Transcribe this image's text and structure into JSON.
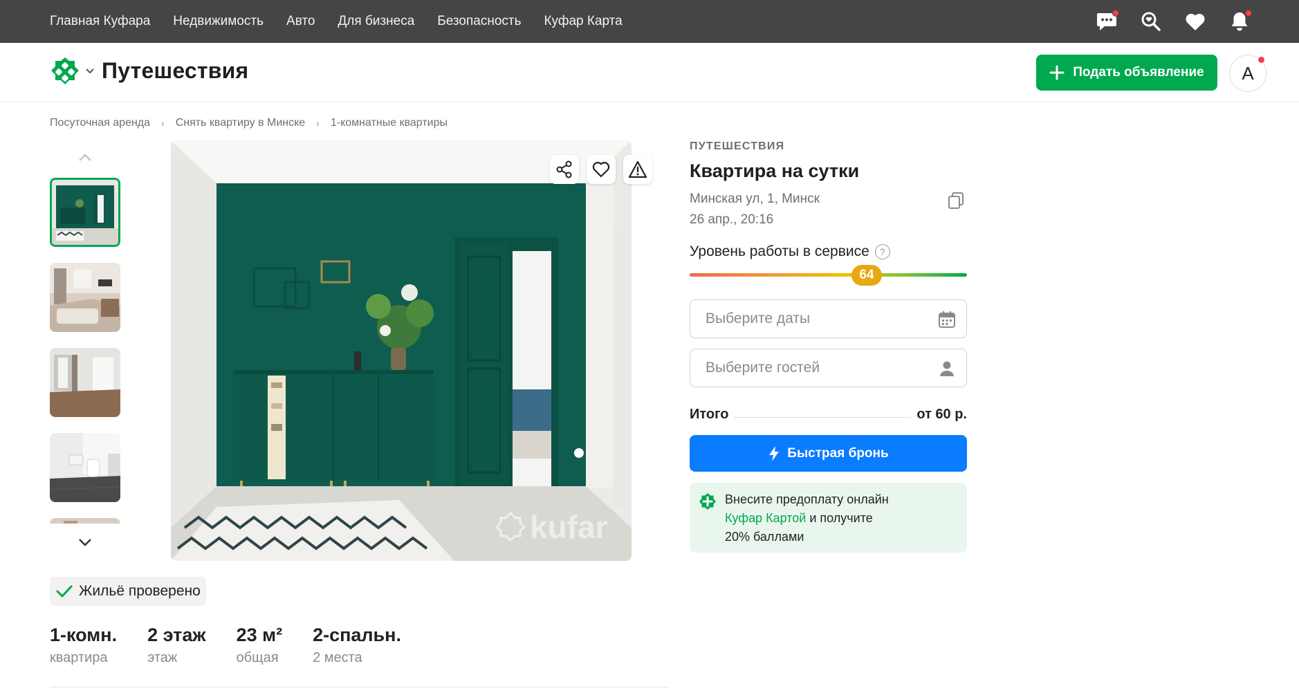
{
  "topnav": {
    "links": [
      "Главная Куфара",
      "Недвижимость",
      "Авто",
      "Для бизнеса",
      "Безопасность",
      "Куфар Карта"
    ],
    "icons": [
      "messages-icon",
      "saved-search-icon",
      "favorites-icon",
      "notifications-icon"
    ]
  },
  "header": {
    "section_title": "Путешествия",
    "post_button_label": "Подать объявление",
    "avatar_letter": "A"
  },
  "breadcrumb": [
    "Посуточная аренда",
    "Снять квартиру в Минске",
    "1-комнатные квартиры"
  ],
  "gallery": {
    "thumbnail_count_visible": 5,
    "active_thumbnail": 1,
    "watermark": "kufar"
  },
  "listing": {
    "category": "ПУТЕШЕСТВИЯ",
    "title": "Квартира на сутки",
    "address": "Минская ул, 1, Минск",
    "date": "26 апр., 20:16",
    "service_level_label": "Уровень работы в сервисе",
    "service_level_value": "64",
    "service_level_max": 100,
    "dates_placeholder": "Выберите даты",
    "guests_placeholder": "Выберите гостей",
    "total_label": "Итого",
    "total_value": "от 60 р.",
    "book_button_label": "Быстрая бронь",
    "promo": {
      "line1": "Внесите предоплату онлайн",
      "link": "Куфар Картой",
      "line2_rest": " и получите",
      "line3": "20% баллами"
    }
  },
  "verified_label": "Жильё проверено",
  "stats": [
    {
      "value": "1-комн.",
      "label": "квартира"
    },
    {
      "value": "2 этаж",
      "label": "этаж"
    },
    {
      "value": "23 м²",
      "label": "общая"
    },
    {
      "value": "2-спальн.",
      "label": "2 места"
    }
  ],
  "colors": {
    "topbar": "#454545",
    "brand_green": "#00a84f",
    "book_blue": "#0a7cff",
    "level_badge": "#e7a811",
    "promo_bg": "#e9f6ee"
  }
}
